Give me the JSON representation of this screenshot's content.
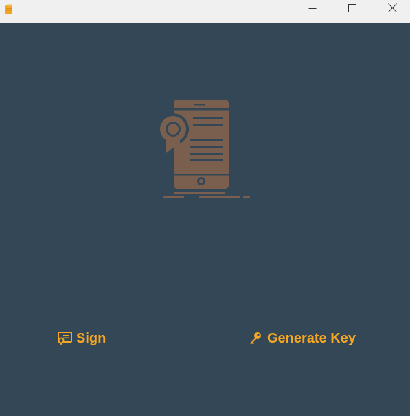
{
  "titlebar": {
    "app_icon": "document-icon",
    "minimize_icon": "minimize-icon",
    "maximize_icon": "maximize-icon",
    "close_icon": "close-icon"
  },
  "hero": {
    "icon": "mobile-certificate-icon"
  },
  "actions": [
    {
      "label": "Sign",
      "icon": "certificate-sign-icon"
    },
    {
      "label": "Generate Key",
      "icon": "key-icon"
    }
  ],
  "colors": {
    "background": "#334756",
    "accent": "#f5a623",
    "hero": "#7a5f4f",
    "titlebar": "#f0f0f0"
  }
}
